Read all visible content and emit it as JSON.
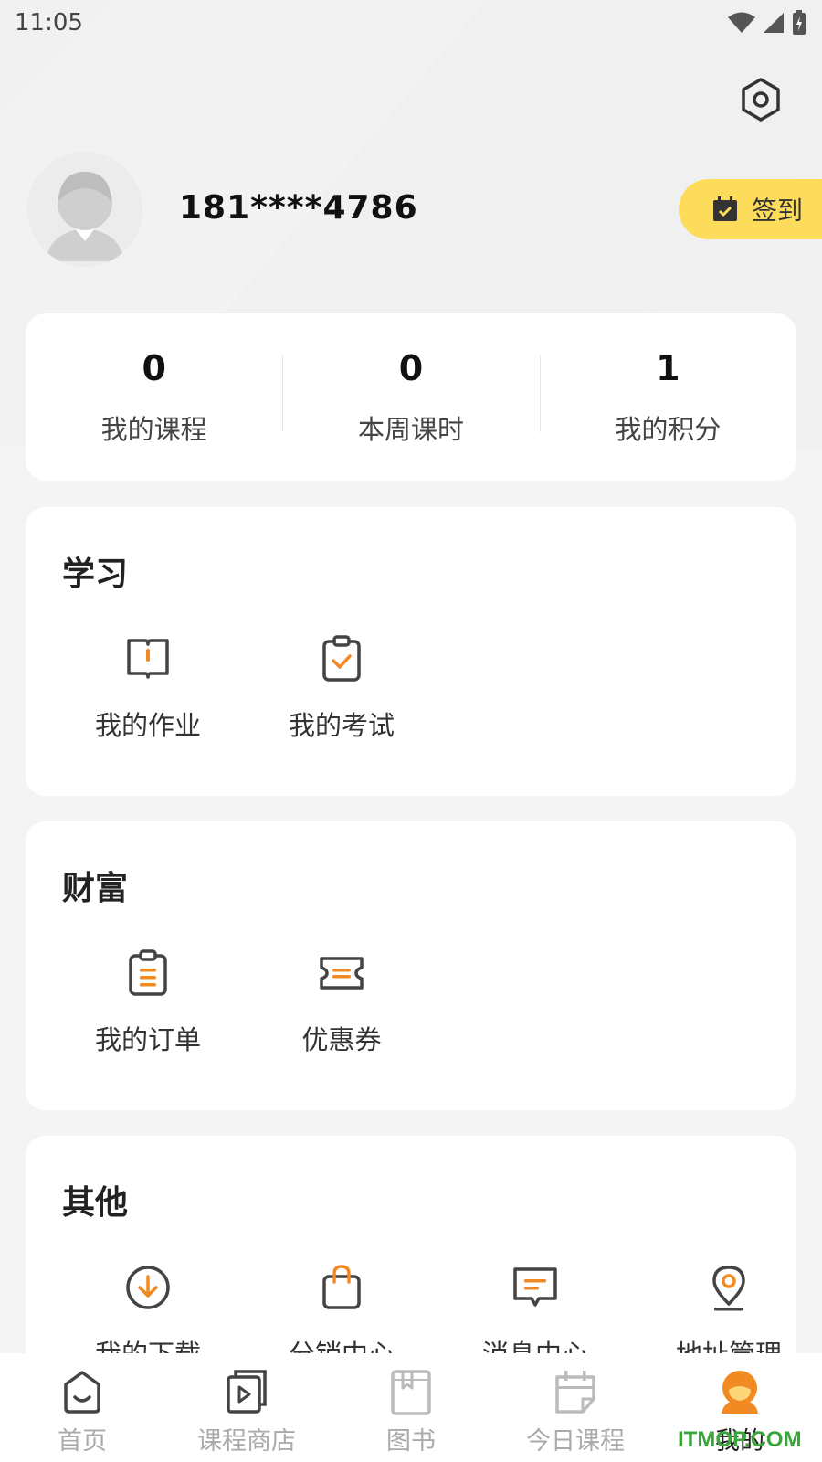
{
  "status_bar": {
    "time": "11:05"
  },
  "profile": {
    "phone": "181****4786",
    "signin_label": "签到"
  },
  "stats": [
    {
      "value": "0",
      "label": "我的课程"
    },
    {
      "value": "0",
      "label": "本周课时"
    },
    {
      "value": "1",
      "label": "我的积分"
    }
  ],
  "sections": {
    "study": {
      "title": "学习",
      "items": [
        {
          "label": "我的作业"
        },
        {
          "label": "我的考试"
        }
      ]
    },
    "wealth": {
      "title": "财富",
      "items": [
        {
          "label": "我的订单"
        },
        {
          "label": "优惠券"
        }
      ]
    },
    "others": {
      "title": "其他",
      "items": [
        {
          "label": "我的下载"
        },
        {
          "label": "分销中心"
        },
        {
          "label": "消息中心"
        },
        {
          "label": "地址管理"
        }
      ]
    }
  },
  "tabbar": [
    {
      "label": "首页"
    },
    {
      "label": "课程商店"
    },
    {
      "label": "图书"
    },
    {
      "label": "今日课程"
    },
    {
      "label": "我的"
    }
  ],
  "watermark": "ITMOP.COM",
  "colors": {
    "accent": "#f28a23",
    "signin_bg": "#fddc5c",
    "icon_gray": "#444444"
  }
}
